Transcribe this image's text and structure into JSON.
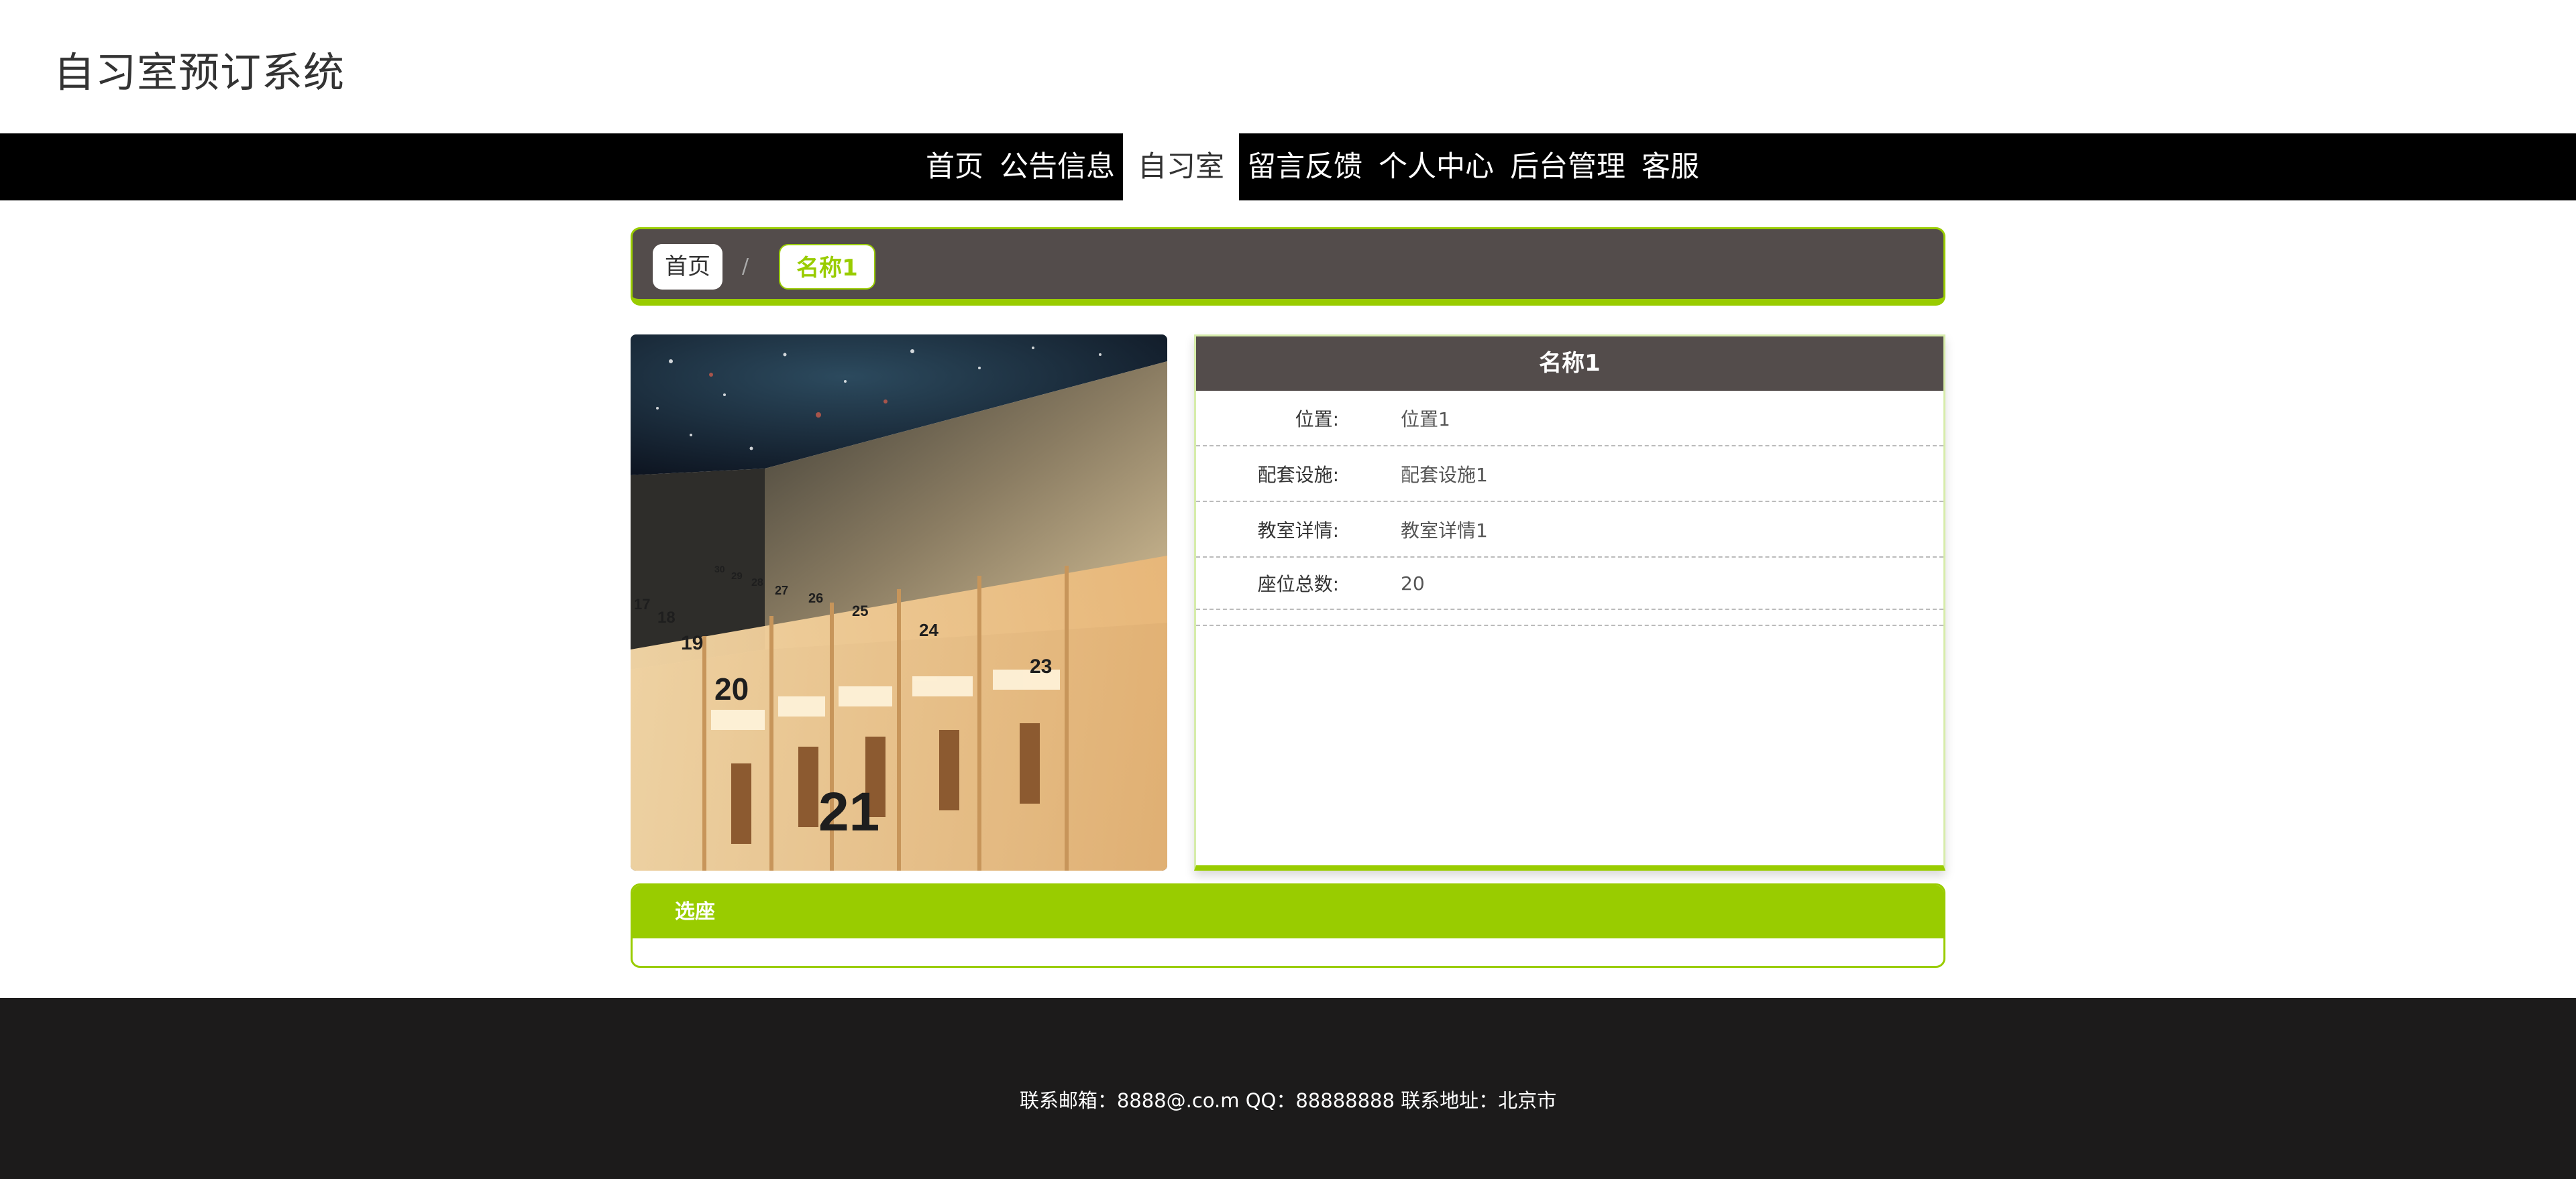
{
  "header": {
    "site_title": "自习室预订系统"
  },
  "nav": {
    "items": [
      {
        "label": "首页",
        "active": false
      },
      {
        "label": "公告信息",
        "active": false
      },
      {
        "label": "自习室",
        "active": true
      },
      {
        "label": "留言反馈",
        "active": false
      },
      {
        "label": "个人中心",
        "active": false
      },
      {
        "label": "后台管理",
        "active": false
      },
      {
        "label": "客服",
        "active": false
      }
    ]
  },
  "breadcrumb": {
    "home": "首页",
    "separator": "/",
    "current": "名称1"
  },
  "detail": {
    "title": "名称1",
    "rows": [
      {
        "label": "位置:",
        "value": "位置1"
      },
      {
        "label": "配套设施:",
        "value": "配套设施1"
      },
      {
        "label": "教室详情:",
        "value": "教室详情1"
      },
      {
        "label": "座位总数:",
        "value": "20"
      }
    ]
  },
  "seat_section": {
    "title": "选座"
  },
  "footer": {
    "text": "联系邮箱：8888@.co.m QQ：88888888 联系地址：北京市"
  },
  "photo": {
    "seat_numbers": [
      "17",
      "18",
      "19",
      "20",
      "21",
      "23",
      "24",
      "25",
      "26",
      "27",
      "28",
      "29",
      "30"
    ]
  },
  "colors": {
    "accent": "#99cc00",
    "panel_dark": "#534c4b",
    "nav_bg": "#000000",
    "footer_bg": "#1c1b1b"
  }
}
